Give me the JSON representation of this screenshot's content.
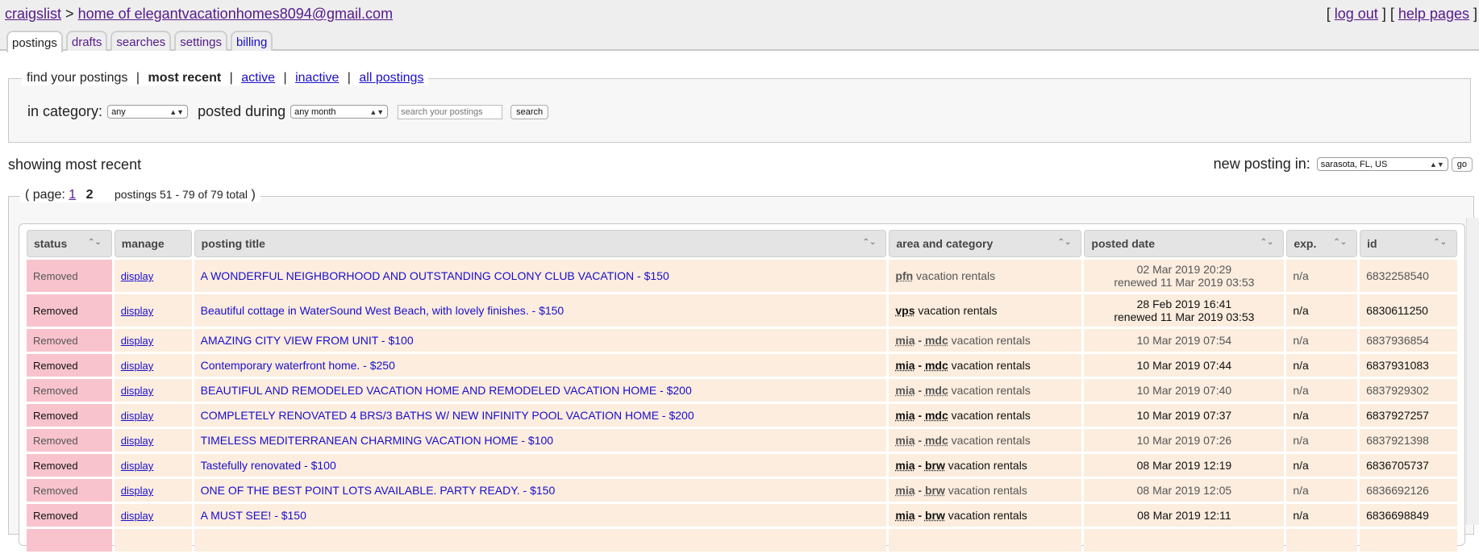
{
  "header": {
    "site_link": "craigslist",
    "separator": ">",
    "home_link": "home of elegantvacationhomes8094@gmail.com",
    "logout_open": "[",
    "logout_link": "log out",
    "logout_close": "]",
    "help_open": "[",
    "help_link": "help pages",
    "help_close": "]"
  },
  "tabs": [
    {
      "label": "postings",
      "active": true
    },
    {
      "label": "drafts"
    },
    {
      "label": "searches"
    },
    {
      "label": "settings"
    },
    {
      "label": "billing"
    }
  ],
  "find": {
    "legend_label": "find your postings",
    "current": "most recent",
    "links": [
      "active",
      "inactive",
      "all postings"
    ],
    "category_label": "in category:",
    "category_value": "any",
    "posted_label": "posted during",
    "posted_value": "any month",
    "search_placeholder": "search your postings",
    "search_button": "search"
  },
  "showing_label": "showing most recent",
  "new_posting": {
    "label": "new posting in:",
    "value": "sarasota, FL, US",
    "go_button": "go"
  },
  "pagination": {
    "open": "( page:",
    "page_link": "1",
    "current_page": "2",
    "count_text": "postings 51 - 79 of 79 total",
    "close": ")"
  },
  "table": {
    "columns": [
      "status",
      "manage",
      "posting title",
      "area and category",
      "posted date",
      "exp.",
      "id"
    ],
    "rows": [
      {
        "status": "Removed",
        "manage": "display",
        "title": "A WONDERFUL NEIGHBORHOOD AND OUTSTANDING COLONY CLUB VACATION - $150",
        "area": "pfn",
        "subarea": "",
        "category": "vacation rentals",
        "date": "02 Mar 2019 20:29",
        "renewed": "renewed 11 Mar 2019 03:53",
        "exp": "n/a",
        "id": "6832258540"
      },
      {
        "status": "Removed",
        "manage": "display",
        "title": "Beautiful cottage in WaterSound West Beach, with lovely finishes. - $150",
        "area": "vps",
        "subarea": "",
        "category": "vacation rentals",
        "date": "28 Feb 2019 16:41",
        "renewed": "renewed 11 Mar 2019 03:53",
        "exp": "n/a",
        "id": "6830611250"
      },
      {
        "status": "Removed",
        "manage": "display",
        "title": "AMAZING CITY VIEW FROM UNIT - $100",
        "area": "mia",
        "subarea": "mdc",
        "category": "vacation rentals",
        "date": "10 Mar 2019 07:54",
        "renewed": "",
        "exp": "n/a",
        "id": "6837936854"
      },
      {
        "status": "Removed",
        "manage": "display",
        "title": "Contemporary waterfront home. - $250",
        "area": "mia",
        "subarea": "mdc",
        "category": "vacation rentals",
        "date": "10 Mar 2019 07:44",
        "renewed": "",
        "exp": "n/a",
        "id": "6837931083"
      },
      {
        "status": "Removed",
        "manage": "display",
        "title": "BEAUTIFUL AND REMODELED VACATION HOME AND REMODELED VACATION HOME - $200",
        "area": "mia",
        "subarea": "mdc",
        "category": "vacation rentals",
        "date": "10 Mar 2019 07:40",
        "renewed": "",
        "exp": "n/a",
        "id": "6837929302"
      },
      {
        "status": "Removed",
        "manage": "display",
        "title": "COMPLETELY RENOVATED 4 BRS/3 BATHS W/ NEW INFINITY POOL VACATION HOME - $200",
        "area": "mia",
        "subarea": "mdc",
        "category": "vacation rentals",
        "date": "10 Mar 2019 07:37",
        "renewed": "",
        "exp": "n/a",
        "id": "6837927257"
      },
      {
        "status": "Removed",
        "manage": "display",
        "title": "TIMELESS MEDITERRANEAN CHARMING VACATION HOME - $100",
        "area": "mia",
        "subarea": "mdc",
        "category": "vacation rentals",
        "date": "10 Mar 2019 07:26",
        "renewed": "",
        "exp": "n/a",
        "id": "6837921398"
      },
      {
        "status": "Removed",
        "manage": "display",
        "title": "Tastefully renovated - $100",
        "area": "mia",
        "subarea": "brw",
        "category": "vacation rentals",
        "date": "08 Mar 2019 12:19",
        "renewed": "",
        "exp": "n/a",
        "id": "6836705737"
      },
      {
        "status": "Removed",
        "manage": "display",
        "title": "ONE OF THE BEST POINT LOTS AVAILABLE. PARTY READY. - $150",
        "area": "mia",
        "subarea": "brw",
        "category": "vacation rentals",
        "date": "08 Mar 2019 12:05",
        "renewed": "",
        "exp": "n/a",
        "id": "6836692126"
      },
      {
        "status": "Removed",
        "manage": "display",
        "title": "A MUST SEE! - $150",
        "area": "mia",
        "subarea": "brw",
        "category": "vacation rentals",
        "date": "08 Mar 2019 12:11",
        "renewed": "",
        "exp": "n/a",
        "id": "6836698849"
      },
      {
        "status": "",
        "manage": "",
        "title": "",
        "area": "",
        "subarea": "",
        "category": "",
        "date": "",
        "renewed": "",
        "exp": "",
        "id": ""
      }
    ]
  },
  "colors": {
    "link_visited": "#551a8b",
    "link": "#1a0dcc",
    "removed_bg": "#f8c3cd",
    "row_bg": "#fcedde",
    "header_bg": "#e4e4e4"
  }
}
